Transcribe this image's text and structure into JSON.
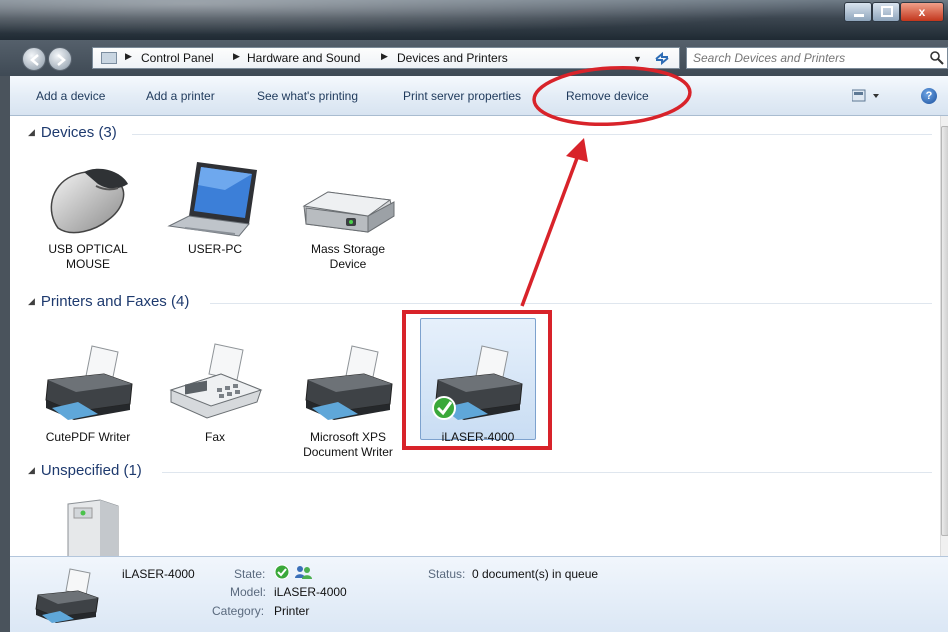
{
  "window": {
    "controls": [
      "minimize",
      "maximize",
      "close"
    ],
    "close_symbol": "x"
  },
  "address_bar": {
    "breadcrumbs": [
      "Control Panel",
      "Hardware and Sound",
      "Devices and Printers"
    ],
    "search_placeholder": "Search Devices and Printers"
  },
  "toolbar": {
    "add_device": "Add a device",
    "add_printer": "Add a printer",
    "see_printing": "See what's printing",
    "print_server": "Print server properties",
    "remove_device": "Remove device",
    "help": "?"
  },
  "groups": {
    "devices": {
      "title": "Devices (3)",
      "items": [
        {
          "label": "USB OPTICAL MOUSE",
          "icon": "mouse-icon"
        },
        {
          "label": "USER-PC",
          "icon": "laptop-icon"
        },
        {
          "label": "Mass Storage Device",
          "icon": "drive-icon"
        }
      ]
    },
    "printers": {
      "title": "Printers and Faxes (4)",
      "items": [
        {
          "label": "CutePDF Writer",
          "icon": "printer-icon"
        },
        {
          "label": "Fax",
          "icon": "fax-icon"
        },
        {
          "label": "Microsoft XPS Document Writer",
          "icon": "printer-icon"
        },
        {
          "label": "iLASER-4000",
          "icon": "printer-icon",
          "selected": true,
          "default": true
        }
      ]
    },
    "unspecified": {
      "title": "Unspecified (1)",
      "items": [
        {
          "label": "",
          "icon": "computer-tower-icon"
        }
      ]
    }
  },
  "details": {
    "name": "iLASER-4000",
    "state_label": "State:",
    "model_label": "Model:",
    "model_value": "iLASER-4000",
    "category_label": "Category:",
    "category_value": "Printer",
    "status_label": "Status:",
    "status_value": "0 document(s) in queue"
  },
  "colors": {
    "annotation": "#d8232a",
    "link_text": "#1e395b",
    "group_header": "#1e3a6e"
  }
}
